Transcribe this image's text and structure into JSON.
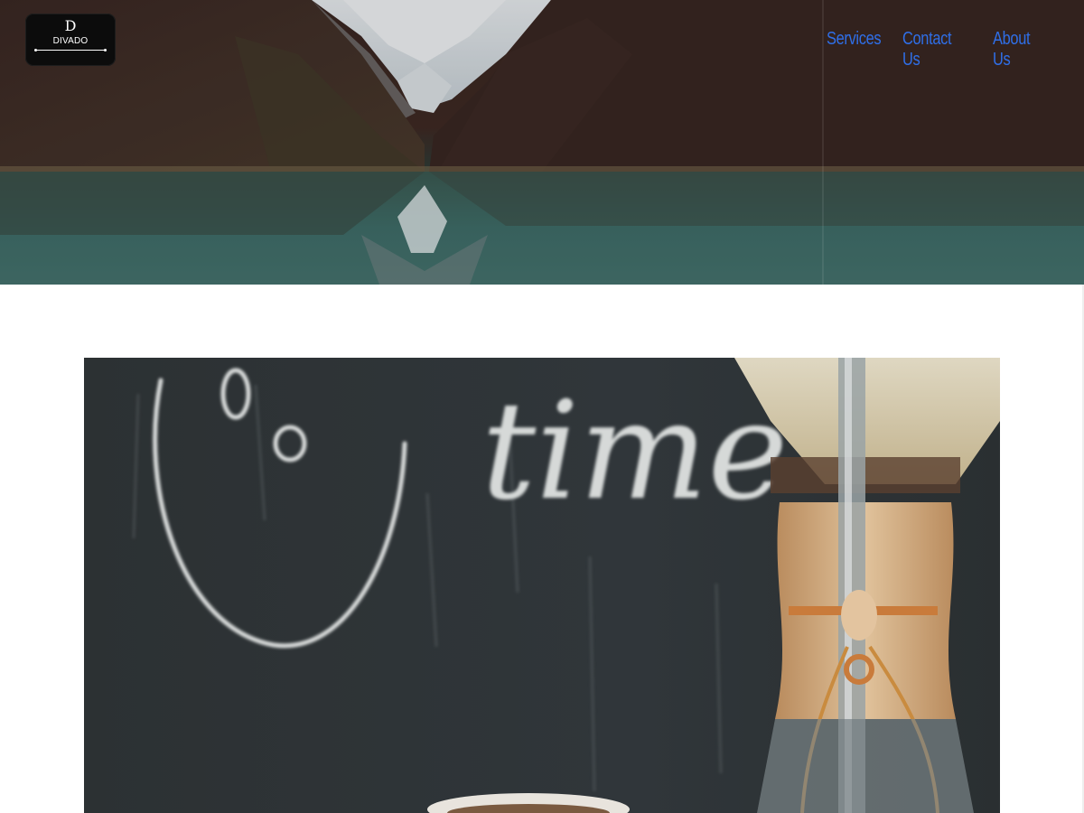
{
  "header": {
    "logo": {
      "monogram": "D",
      "name": "DIVADO"
    },
    "nav": [
      {
        "label": "Services"
      },
      {
        "label": "Contact Us"
      },
      {
        "label": "About Us"
      }
    ]
  },
  "hero": {
    "image": "mountain-lake-background"
  },
  "feature": {
    "image": "chalkboard-coffee-photo",
    "chalk_text": "time"
  },
  "colors": {
    "nav_link": "#2f6fe8",
    "logo_bg": "#0c0c0c",
    "page_bg": "#ffffff"
  }
}
